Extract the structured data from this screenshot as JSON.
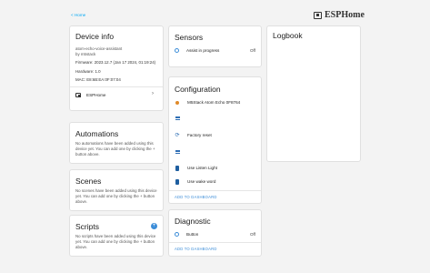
{
  "nav": {
    "back_label": "< Home"
  },
  "brand": {
    "name": "ESPHome"
  },
  "device_info": {
    "title": "Device info",
    "model": "atom-echo-voice-assistant",
    "manufacturer": "by m5stack",
    "firmware": "Firmware: 2023.12.7 (Jan 17 2024, 01:19:24)",
    "hardware": "Hardware: 1.0",
    "mac": "MAC: E8:6B:EA:0F:07:04",
    "link_label": "ESPHome"
  },
  "automations": {
    "title": "Automations",
    "text": "No automations have been added using this device yet. You can add one by clicking the + button above."
  },
  "scenes": {
    "title": "Scenes",
    "text": "No scenes have been added using this device yet. You can add one by clicking the + button above."
  },
  "scripts": {
    "title": "Scripts",
    "text": "No scripts have been added using this device yet. You can add one by clicking the + button above."
  },
  "sensors": {
    "title": "Sensors",
    "items": [
      {
        "label": "Assist in progress",
        "value": "Off"
      }
    ]
  },
  "configuration": {
    "title": "Configuration",
    "items": [
      {
        "label": "M5Stack Atom Echo 0F8764",
        "icon": "bulb-icon"
      },
      {
        "label": "",
        "icon": "list-icon"
      },
      {
        "label": "Factory reset",
        "icon": "restart-icon"
      },
      {
        "label": "",
        "icon": "list-icon"
      },
      {
        "label": "Use Listen Light",
        "icon": "switch-icon"
      },
      {
        "label": "Use wake word",
        "icon": "switch-icon"
      }
    ],
    "action": "ADD TO DASHBOARD"
  },
  "diagnostic": {
    "title": "Diagnostic",
    "items": [
      {
        "label": "Button",
        "value": "Off"
      }
    ],
    "action": "ADD TO DASHBOARD"
  },
  "logbook": {
    "title": "Logbook"
  },
  "colors": {
    "accent": "#3c8dd8",
    "link": "#03a9f4",
    "background": "#f3f3f3"
  }
}
